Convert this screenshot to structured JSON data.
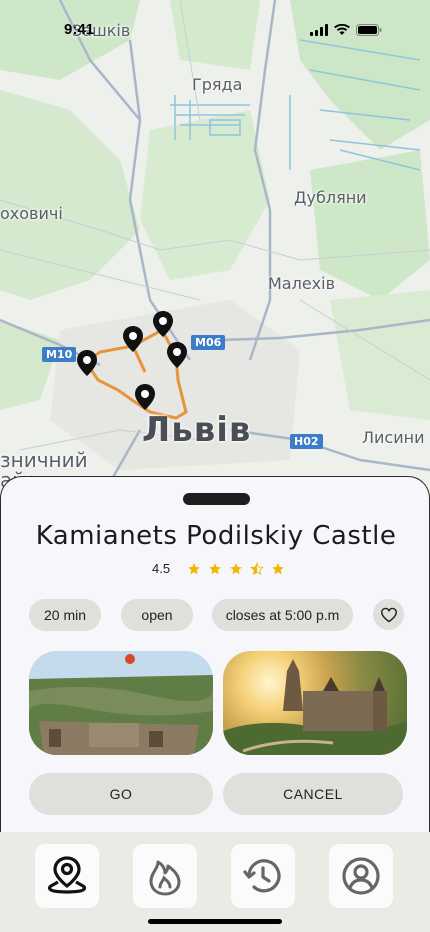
{
  "status": {
    "time": "9:41"
  },
  "map": {
    "labels": {
      "top": "Зашків",
      "hryada": "Гряда",
      "dublyany": "Дубляни",
      "left": "оховичі",
      "malekhiv": "Малехів",
      "city": "Львів",
      "lysynychi": "Лисини",
      "bottom_left_1": "зничний",
      "bottom_left_2": "айон"
    },
    "road_badges": {
      "m10": "M10",
      "m06": "M06",
      "h02": "H02"
    },
    "route_color": "#e8943a"
  },
  "place": {
    "title": "Kamianets Podilskiy Castle",
    "rating": "4.5",
    "star_color": "#f2b600"
  },
  "chips": {
    "duration": "20 min",
    "status": "open",
    "closes": "closes at 5:00 p.m"
  },
  "actions": {
    "go": "GO",
    "cancel": "CANCEL"
  },
  "tabs": [
    "map-pin-icon",
    "flame-icon",
    "history-icon",
    "profile-icon"
  ]
}
